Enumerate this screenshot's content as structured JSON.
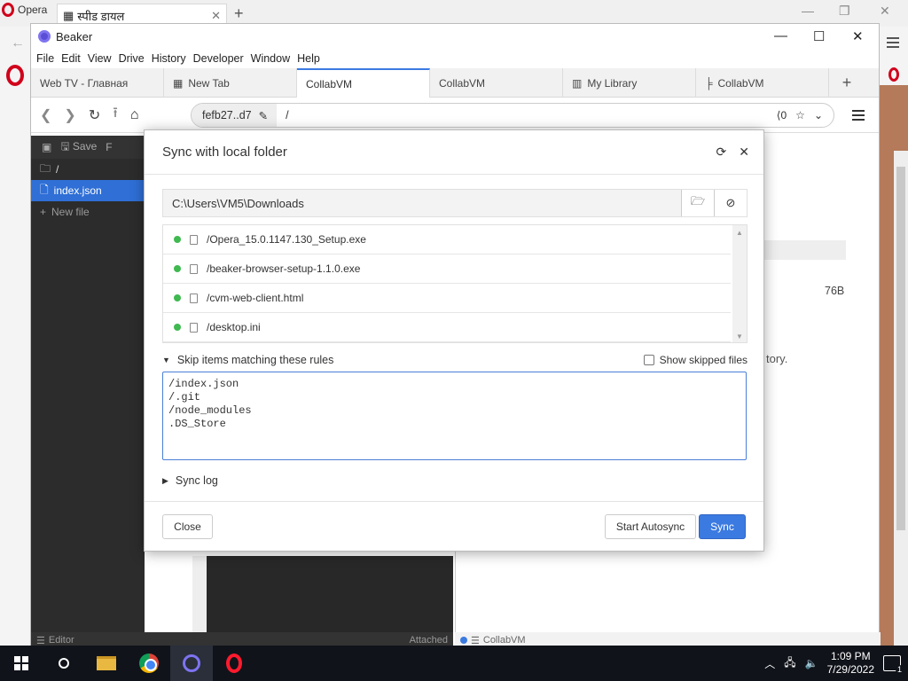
{
  "opera": {
    "app_label": "Opera",
    "tab_title": "स्पीड डायल"
  },
  "beaker": {
    "window_title": "Beaker",
    "menu": [
      "File",
      "Edit",
      "View",
      "Drive",
      "History",
      "Developer",
      "Window",
      "Help"
    ],
    "tabs": [
      {
        "label": "Web TV - Главная",
        "active": false
      },
      {
        "label": "New Tab",
        "active": false
      },
      {
        "label": "CollabVM",
        "active": true
      },
      {
        "label": "CollabVM",
        "active": false
      },
      {
        "label": "My Library",
        "active": false
      },
      {
        "label": "CollabVM",
        "active": false
      }
    ],
    "url": {
      "host": "fefb27..d7",
      "path": "/",
      "share_count": "0"
    },
    "editor": {
      "toolbar_save": "Save",
      "toolbar_extra": "F",
      "root": "/",
      "selected_file": "index.json",
      "new_file": "New file",
      "status_left": "Editor",
      "status_right": "Attached"
    },
    "preview": {
      "size": "76B",
      "partial_text": "tory.",
      "status": "CollabVM"
    }
  },
  "modal": {
    "title": "Sync with local folder",
    "folder_path": "C:\\Users\\VM5\\Downloads",
    "files": [
      "/Opera_15.0.1147.130_Setup.exe",
      "/beaker-browser-setup-1.1.0.exe",
      "/cvm-web-client.html",
      "/desktop.ini"
    ],
    "skip_label": "Skip items matching these rules",
    "show_skipped_label": "Show skipped files",
    "rules": [
      "/index.json",
      "/.git",
      "/node_modules",
      ".DS_Store"
    ],
    "sync_log_label": "Sync log",
    "close_label": "Close",
    "autosync_label": "Start Autosync",
    "sync_label": "Sync",
    "accent": "#3b7ae0",
    "status_dot_color": "#3fb950"
  },
  "taskbar": {
    "time": "1:09 PM",
    "date": "7/29/2022",
    "notif_count": "1"
  }
}
